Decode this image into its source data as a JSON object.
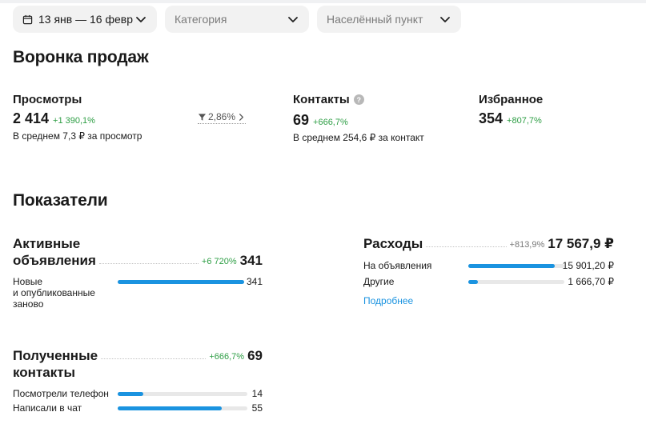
{
  "filters": {
    "date_range": "13 янв — 16 февр",
    "category_placeholder": "Категория",
    "location_placeholder": "Населённый пункт"
  },
  "funnel": {
    "title": "Воронка продаж",
    "views": {
      "title": "Просмотры",
      "value": "2 414",
      "delta": "+1 390,1%",
      "sub": "В среднем 7,3 ₽ за просмотр",
      "conversion": "2,86%"
    },
    "contacts": {
      "title": "Контакты",
      "value": "69",
      "delta": "+666,7%",
      "sub": "В среднем 254,6 ₽ за контакт"
    },
    "favorites": {
      "title": "Избранное",
      "value": "354",
      "delta": "+807,7%"
    }
  },
  "indicators": {
    "title": "Показатели",
    "active_ads": {
      "title_line1": "Активные",
      "title_line2": "объявления",
      "delta": "+6 720%",
      "value": "341",
      "rows": [
        {
          "label_lines": [
            "Новые",
            "и опубликованные",
            "заново"
          ],
          "value": "341",
          "fraction": 1.0
        }
      ]
    },
    "received_contacts": {
      "title_line1": "Полученные",
      "title_line2": "контакты",
      "delta": "+666,7%",
      "value": "69",
      "rows": [
        {
          "label": "Посмотрели телефон",
          "value": "14",
          "fraction": 0.2
        },
        {
          "label": "Написали в чат",
          "value": "55",
          "fraction": 0.8
        }
      ]
    },
    "expenses": {
      "title": "Расходы",
      "delta": "+813,9%",
      "value": "17 567,9 ₽",
      "rows": [
        {
          "label": "На объявления",
          "value": "15 901,20 ₽",
          "fraction": 0.9
        },
        {
          "label": "Другие",
          "value": "1 666,70 ₽",
          "fraction": 0.1
        }
      ],
      "more_link": "Подробнее"
    }
  },
  "colors": {
    "accent": "#1a93e0",
    "positive": "#2e9e45",
    "track": "#e8e8e8"
  }
}
